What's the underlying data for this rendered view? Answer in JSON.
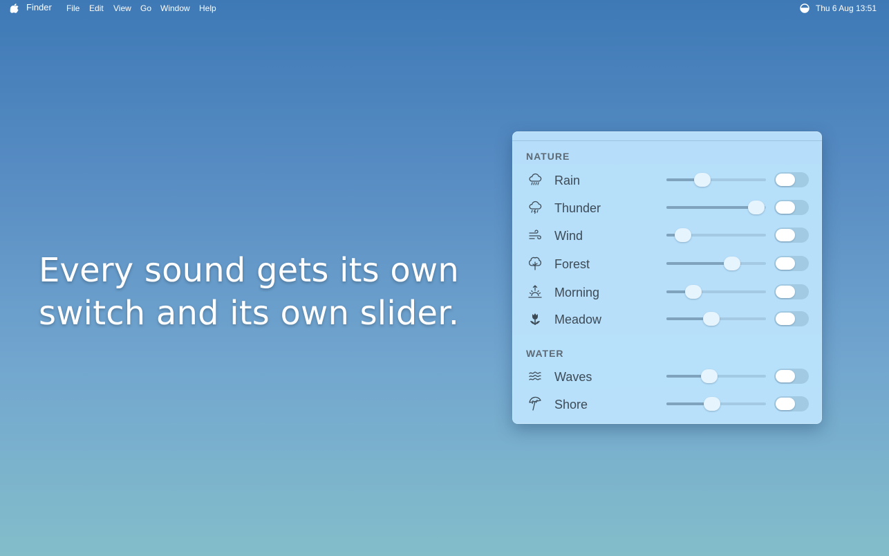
{
  "menubar": {
    "app_name": "Finder",
    "items": [
      "File",
      "Edit",
      "View",
      "Go",
      "Window",
      "Help"
    ],
    "clock": "Thu 6 Aug  13:51"
  },
  "headline": {
    "line1": "Every sound gets its own",
    "line2": "switch and its own slider."
  },
  "panel": {
    "sections": [
      {
        "title": "NATURE",
        "rows": [
          {
            "label": "Rain",
            "icon": "cloud-rain-icon",
            "volume": 0.36,
            "enabled": false
          },
          {
            "label": "Thunder",
            "icon": "cloud-bolt-icon",
            "volume": 0.9,
            "enabled": false
          },
          {
            "label": "Wind",
            "icon": "wind-icon",
            "volume": 0.17,
            "enabled": false
          },
          {
            "label": "Forest",
            "icon": "tree-icon",
            "volume": 0.66,
            "enabled": false
          },
          {
            "label": "Morning",
            "icon": "sunrise-icon",
            "volume": 0.27,
            "enabled": false
          },
          {
            "label": "Meadow",
            "icon": "tulip-icon",
            "volume": 0.45,
            "enabled": false
          }
        ]
      },
      {
        "title": "WATER",
        "rows": [
          {
            "label": "Waves",
            "icon": "water-waves-icon",
            "volume": 0.43,
            "enabled": false
          },
          {
            "label": "Shore",
            "icon": "beach-umbrella-icon",
            "volume": 0.46,
            "enabled": false
          }
        ]
      }
    ]
  },
  "colors": {
    "panel_bg": "#bae2fc",
    "label_text": "#3c4a56",
    "section_text": "#5d6a75",
    "desktop_top": "#3e79b6",
    "desktop_bottom": "#83bdca"
  }
}
